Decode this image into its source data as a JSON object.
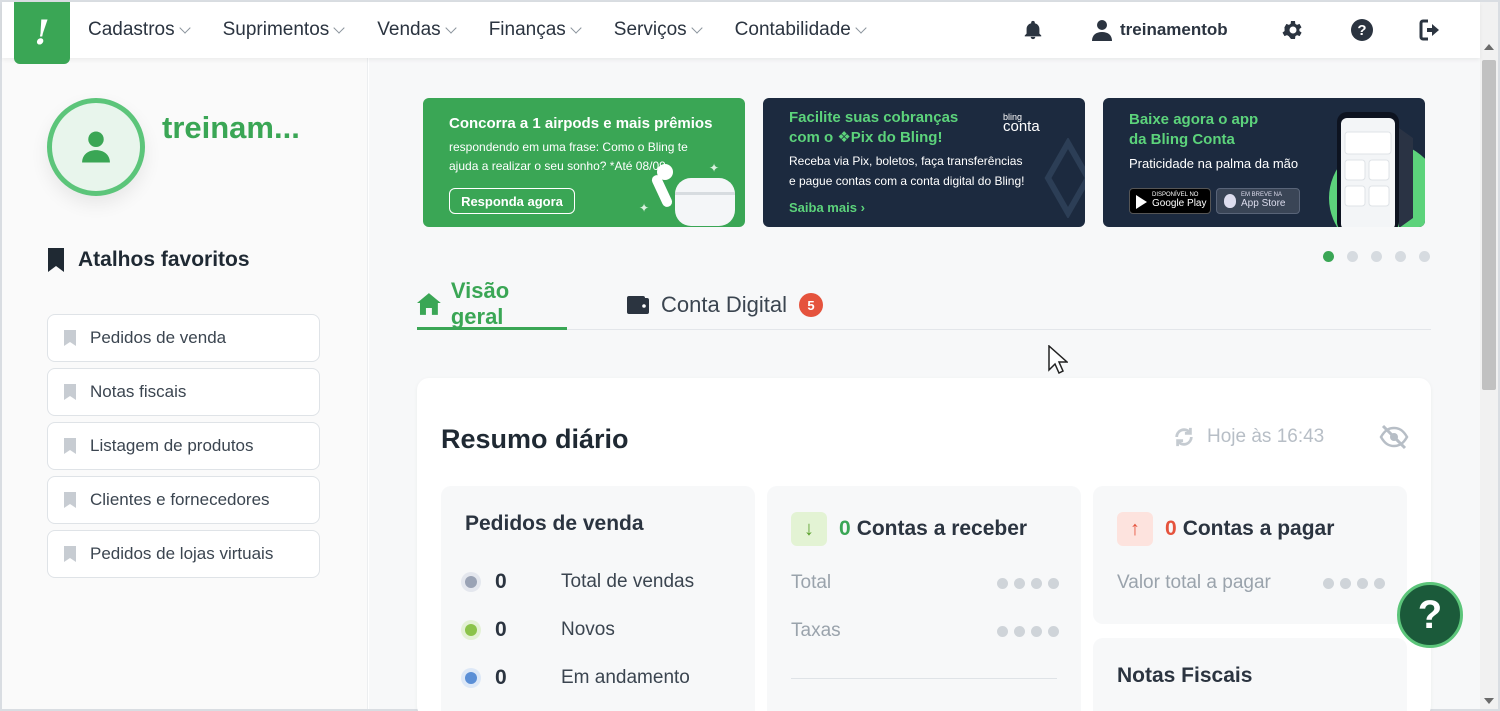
{
  "logo": {
    "glyph": "!"
  },
  "nav": {
    "items": [
      {
        "label": "Cadastros"
      },
      {
        "label": "Suprimentos"
      },
      {
        "label": "Vendas"
      },
      {
        "label": "Finanças"
      },
      {
        "label": "Serviços"
      },
      {
        "label": "Contabilidade"
      }
    ],
    "username": "treinamentob"
  },
  "sidebar": {
    "username": "treinam...",
    "favorites_title": "Atalhos favoritos",
    "favorites": [
      {
        "label": "Pedidos de venda"
      },
      {
        "label": "Notas fiscais"
      },
      {
        "label": "Listagem de produtos"
      },
      {
        "label": "Clientes e fornecedores"
      },
      {
        "label": "Pedidos de lojas virtuais"
      }
    ]
  },
  "banners": [
    {
      "title": "Concorra a 1 airpods e mais prêmios",
      "text1": "respondendo em uma frase: Como o Bling te",
      "text2": "ajuda a realizar o seu sonho? *Até 08/09.",
      "button": "Responda agora"
    },
    {
      "title1": "Facilite suas cobranças",
      "title2": "com o ❖Pix do Bling!",
      "brand_small": "bling",
      "brand": "conta",
      "text1": "Receba via Pix, boletos, faça transferências",
      "text2": "e pague contas com a conta digital do Bling!",
      "link": "Saiba mais"
    },
    {
      "title1": "Baixe agora o app",
      "title2": "da Bling Conta",
      "text": "Praticidade na palma da mão",
      "store1_small": "DISPONÍVEL NO",
      "store1": "Google Play",
      "store2_small": "EM BREVE NA",
      "store2": "App Store"
    }
  ],
  "carousel": {
    "count": 5,
    "active": 0
  },
  "tabs": [
    {
      "label": "Visão geral",
      "active": true
    },
    {
      "label": "Conta Digital",
      "badge": "5"
    }
  ],
  "summary": {
    "title": "Resumo diário",
    "updated": "Hoje às 16:43",
    "sales": {
      "title": "Pedidos de venda",
      "rows": [
        {
          "value": "0",
          "label": "Total de vendas",
          "color": "#9aa3b5"
        },
        {
          "value": "0",
          "label": "Novos",
          "color": "#8bc34a"
        },
        {
          "value": "0",
          "label": "Em andamento",
          "color": "#5b8fd6"
        }
      ]
    },
    "receivable": {
      "count": "0",
      "title": "Contas a receber",
      "rows": [
        {
          "label": "Total"
        },
        {
          "label": "Taxas"
        }
      ]
    },
    "payable": {
      "count": "0",
      "title": "Contas a pagar",
      "rows": [
        {
          "label": "Valor total a pagar"
        }
      ]
    },
    "invoices": {
      "title": "Notas Fiscais"
    }
  },
  "help_fab": {
    "label": "?"
  },
  "colors": {
    "brand": "#3aa655",
    "dark": "#1c2a3f",
    "danger": "#e5533d"
  }
}
